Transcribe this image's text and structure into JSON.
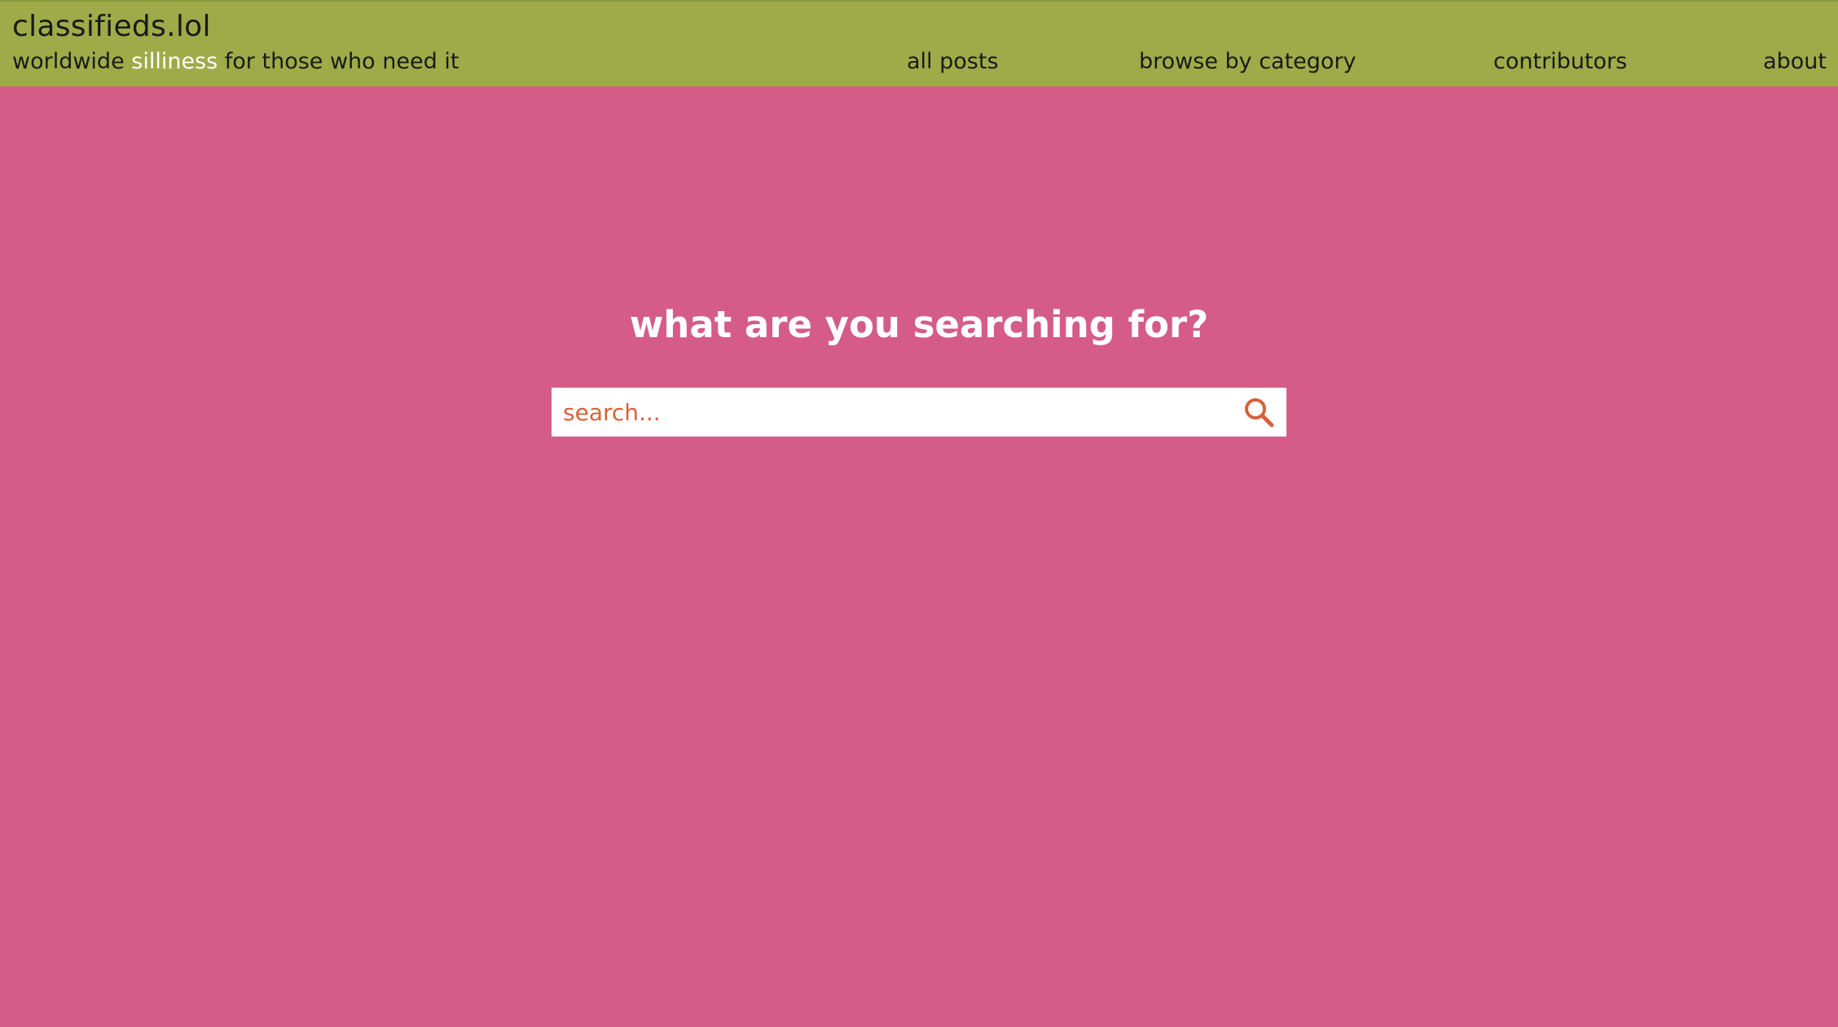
{
  "header": {
    "site_title": "classifieds.lol",
    "tagline": {
      "before": "worldwide ",
      "highlight": "silliness",
      "after": " for those who need it"
    },
    "nav": {
      "all_posts": "all posts",
      "browse_by_category": "browse by category",
      "contributors": "contributors",
      "about": "about"
    }
  },
  "search": {
    "heading": "what are you searching for?",
    "placeholder": "search...",
    "value": "",
    "icon": "search-icon"
  },
  "colors": {
    "header_bg": "#9eab48",
    "page_bg": "#d55c87",
    "accent": "#d9603a",
    "text": "#1a1a1a",
    "highlight": "#ffffff"
  }
}
